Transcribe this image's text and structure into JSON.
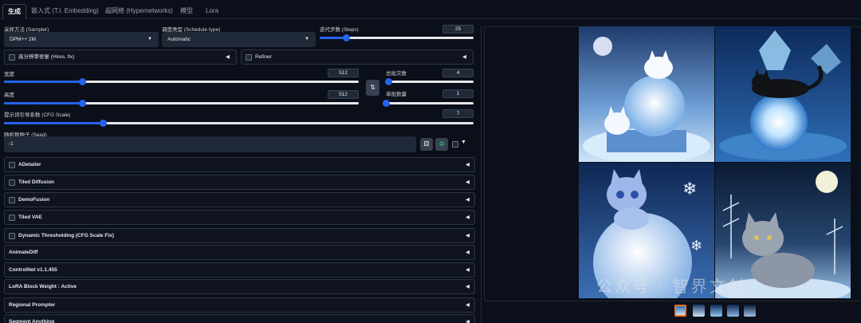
{
  "tabs": [
    "生成",
    "嵌入式 (T.I. Embedding)",
    "超网络 (Hypernetworks)",
    "模型",
    "Lora"
  ],
  "sampler": {
    "label": "采样方法 (Sampler)",
    "value": "DPM++ 2M"
  },
  "schedule": {
    "label": "调度类型 (Schedule type)",
    "value": "Automatic"
  },
  "steps": {
    "label": "迭代步数 (Steps)",
    "value": "25",
    "fraction": 0.17
  },
  "hires": {
    "label": "高分辨率修复 (Hires. fix)"
  },
  "refiner": {
    "label": "Refiner"
  },
  "width": {
    "label": "宽度",
    "value": "512",
    "fraction": 0.22
  },
  "height": {
    "label": "高度",
    "value": "512",
    "fraction": 0.22
  },
  "swap_icon": "swap-icon",
  "batch_count": {
    "label": "总批次数",
    "value": "4",
    "fraction": 0.03
  },
  "batch_size": {
    "label": "单批数量",
    "value": "1",
    "fraction": 0.0
  },
  "cfg": {
    "label": "提示词引导系数 (CFG Scale)",
    "value": "7",
    "fraction": 0.21
  },
  "seed": {
    "label": "随机数种子 (Seed)",
    "value": "-1",
    "dice_icon": "dice-icon",
    "recycle_icon": "recycle-icon"
  },
  "accordions": [
    {
      "label": "ADetailer",
      "checkbox": true
    },
    {
      "label": "Tiled Diffusion",
      "checkbox": true
    },
    {
      "label": "DemoFusion",
      "checkbox": true
    },
    {
      "label": "Tiled VAE",
      "checkbox": true
    },
    {
      "label": "Dynamic Thresholding (CFG Scale Fix)",
      "checkbox": true
    },
    {
      "label": "AnimateDiff",
      "checkbox": false
    },
    {
      "label": "ControlNet v1.1.455",
      "checkbox": false
    },
    {
      "label": "LoRA Block Weight : Active",
      "checkbox": false
    },
    {
      "label": "Regional Prompter",
      "checkbox": false
    },
    {
      "label": "Segment Anything",
      "checkbox": false
    }
  ],
  "watermark": "公众号 · 智界文创",
  "colors": {
    "accent": "#2563eb",
    "background": "#0b0f19",
    "panel": "#1f2937"
  }
}
